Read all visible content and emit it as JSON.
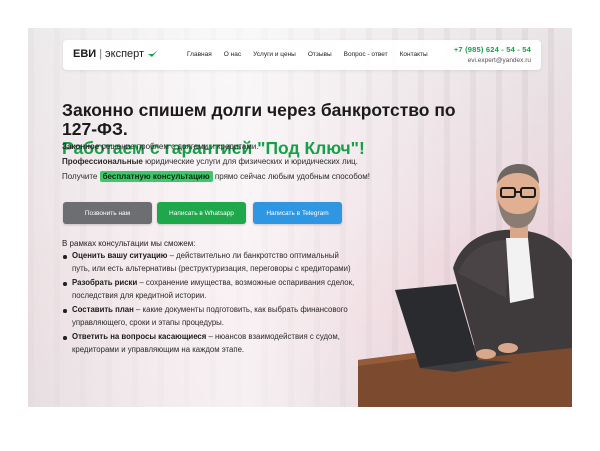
{
  "header": {
    "logo_main": "ЕВИ",
    "logo_sep": "|",
    "logo_second": "эксперт",
    "nav": [
      "Главная",
      "О нас",
      "Услуги и цены",
      "Отзывы",
      "Вопрос - ответ",
      "Контакты"
    ],
    "phone": "+7 (985) 624 - 54 - 54",
    "email": "evi.expert@yandex.ru"
  },
  "hero": {
    "title_line1": "Законно спишем долги через банкротство по 127-ФЗ.",
    "title_line2": "Работаем с гарантией \"Под Ключ\"!",
    "p1_bold": "Законное",
    "p1_rest": " решение проблем с долгами и кредитами.",
    "p2_bold": "Профессиональные",
    "p2_rest": " юридические услуги для физических и юридических лиц.",
    "p3_before": "Получите ",
    "p3_highlight": "бесплатную консультацию",
    "p3_after": " прямо сейчас любым удобным способом!"
  },
  "buttons": {
    "call": "Позвонить нам",
    "whatsapp": "Написать в Whatsapp",
    "telegram": "Написать в Telegram"
  },
  "consult": {
    "title": "В рамках консультации мы сможем:",
    "items": [
      {
        "bold": "Оценить вашу ситуацию",
        "text": " – действительно ли банкротство оптимальный путь, или есть альтернативы (реструктуризация, переговоры с кредиторами)"
      },
      {
        "bold": "Разобрать риски",
        "text": " – сохранение имущества, возможные оспаривания сделок, последствия для кредитной истории."
      },
      {
        "bold": "Составить план",
        "text": " – какие документы подготовить, как выбрать финансового управляющего, сроки и этапы процедуры."
      },
      {
        "bold": "Ответить на вопросы касающиеся",
        "text": " – нюансов взаимодействия с судом, кредиторами и управляющим на каждом этапе."
      }
    ]
  },
  "colors": {
    "accent_green": "#17a04a",
    "button_gray": "#6d6e72",
    "button_green": "#1ea84b",
    "button_blue": "#2f97e2"
  },
  "icons": {
    "logo": "leaf-check-icon"
  }
}
